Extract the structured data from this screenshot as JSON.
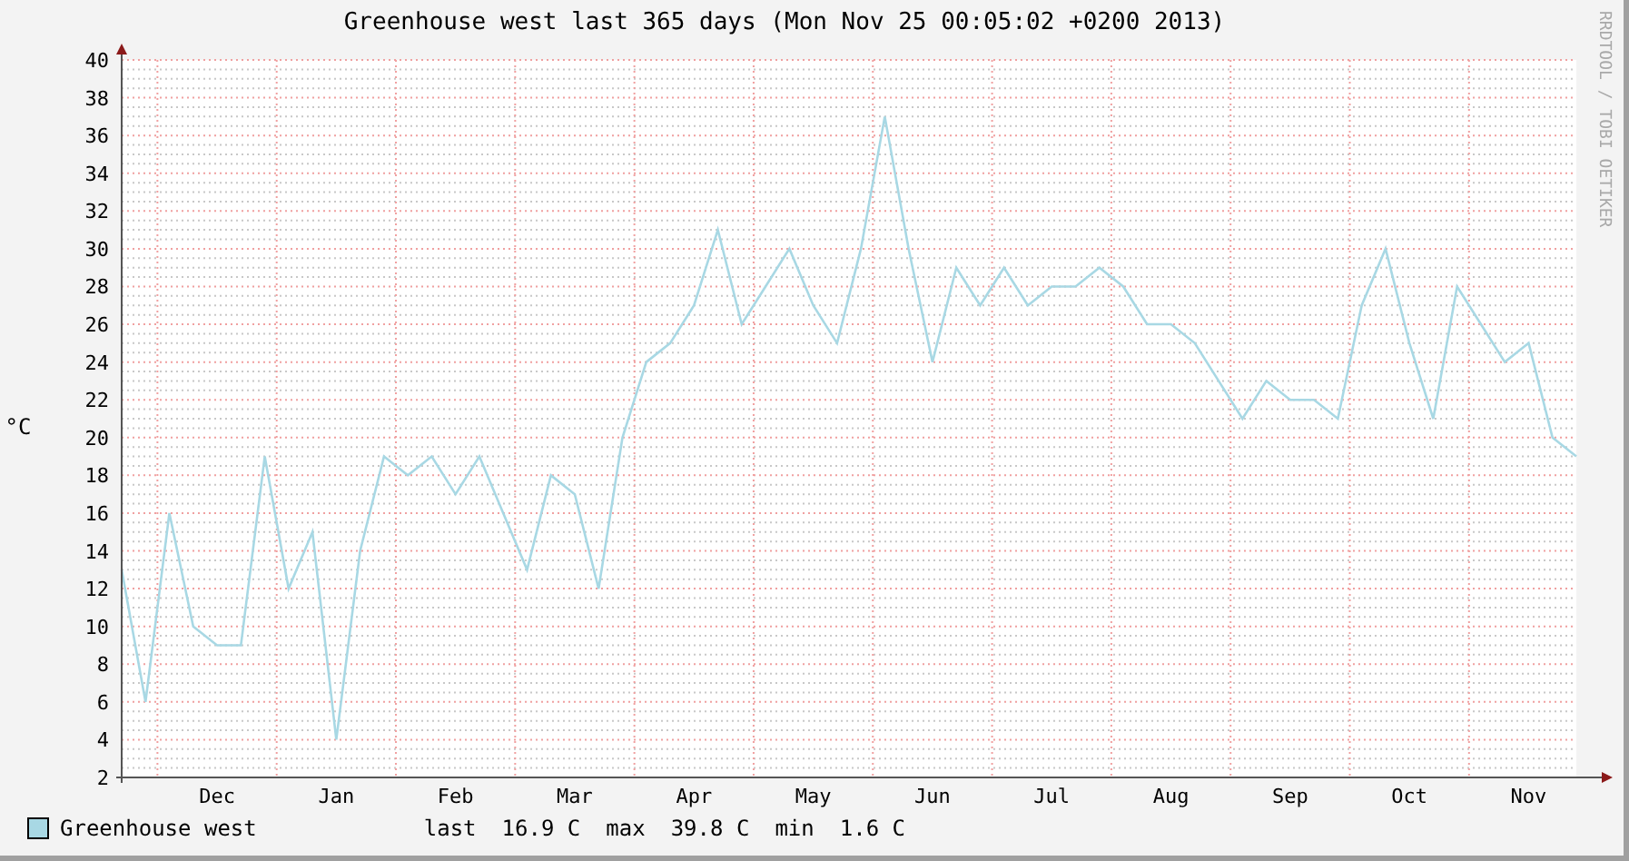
{
  "title": "Greenhouse west last 365 days (Mon Nov 25 00:05:02 +0200 2013)",
  "side_note": "RRDTOOL / TOBI OETIKER",
  "chart_data": {
    "type": "line",
    "grid": true,
    "ylabel": "°C",
    "ylim": [
      2,
      40
    ],
    "yticks": [
      2,
      4,
      6,
      8,
      10,
      12,
      14,
      16,
      18,
      20,
      22,
      24,
      26,
      28,
      30,
      32,
      34,
      36,
      38,
      40
    ],
    "categories": [
      null,
      null,
      null,
      null,
      "Dec",
      null,
      null,
      null,
      null,
      "Jan",
      null,
      null,
      null,
      null,
      "Feb",
      null,
      null,
      null,
      null,
      "Mar",
      null,
      null,
      null,
      null,
      "Apr",
      null,
      null,
      null,
      null,
      "May",
      null,
      null,
      null,
      null,
      "Jun",
      null,
      null,
      null,
      null,
      "Jul",
      null,
      null,
      null,
      null,
      "Aug",
      null,
      null,
      null,
      null,
      "Sep",
      null,
      null,
      null,
      null,
      "Oct",
      null,
      null,
      null,
      null,
      "Nov",
      null,
      null
    ],
    "series": [
      {
        "name": "Greenhouse west",
        "color": "#a8d8e4",
        "values": [
          13,
          6,
          16,
          10,
          9,
          9,
          19,
          12,
          15,
          4,
          14,
          19,
          18,
          19,
          17,
          19,
          16,
          13,
          18,
          17,
          12,
          20,
          24,
          25,
          27,
          31,
          26,
          28,
          30,
          27,
          25,
          30,
          37,
          30,
          24,
          29,
          27,
          29,
          27,
          28,
          28,
          29,
          28,
          26,
          26,
          25,
          23,
          21,
          23,
          22,
          22,
          21,
          27,
          30,
          25,
          21,
          28,
          26,
          24,
          25,
          20,
          19
        ]
      }
    ]
  },
  "legend": {
    "stats": [
      {
        "label": "last",
        "value": "16.9 C"
      },
      {
        "label": "max",
        "value": "39.8 C"
      },
      {
        "label": "min",
        "value": "1.6 C"
      }
    ]
  }
}
